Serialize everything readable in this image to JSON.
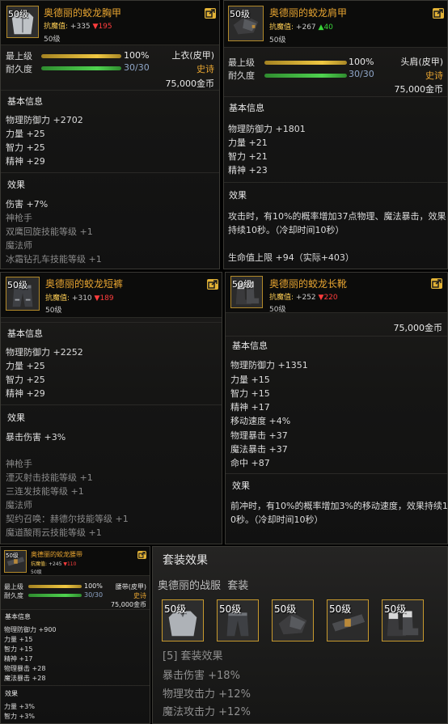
{
  "panels": [
    {
      "level_tag": "50级",
      "name": "奥德丽的蛟龙胸甲",
      "resist_label": "抗魔值:",
      "resist_value": "+335",
      "resist_change": "▼195",
      "level": "50级",
      "max_label": "最上级",
      "max_pct": "100%",
      "max_fill": 1.0,
      "dur_label": "耐久度",
      "dur_value": "30/30",
      "dur_fill": 1.0,
      "slot": "上衣(皮甲)",
      "rarity": "史诗",
      "price": "75,000金币",
      "basic_title": "基本信息",
      "stats": [
        "物理防御力 +2702",
        "力量 +25",
        "智力 +25",
        "精神 +29"
      ],
      "effect_title": "效果",
      "effects": [
        {
          "text": "伤害 +7%",
          "dim": false
        },
        {
          "text": "神枪手",
          "dim": true
        },
        {
          "text": "双鹰回旋技能等级 +1",
          "dim": true
        },
        {
          "text": "魔法师",
          "dim": true
        },
        {
          "text": "冰霜钻孔车技能等级 +1",
          "dim": true
        }
      ]
    },
    {
      "level_tag": "50级",
      "name": "奥德丽的蛟龙肩甲",
      "resist_label": "抗魔值:",
      "resist_value": "+267",
      "resist_change": "▲40",
      "level": "50级",
      "max_label": "最上级",
      "max_pct": "100%",
      "max_fill": 1.0,
      "dur_label": "耐久度",
      "dur_value": "30/30",
      "dur_fill": 1.0,
      "slot": "头肩(皮甲)",
      "rarity": "史诗",
      "price": "75,000金币",
      "basic_title": "基本信息",
      "stats": [
        "物理防御力 +1801",
        "力量 +21",
        "智力 +21",
        "精神 +23"
      ],
      "effect_title": "效果",
      "desc": [
        "攻击时，有10%的概率增加37点物理、魔法暴击，效果",
        "持续10秒。（冷却时间10秒）"
      ],
      "extra": "生命值上限 +94（实际+403）"
    },
    {
      "level_tag": "50级",
      "name": "奥德丽的蛟龙短裤",
      "resist_label": "抗魔值:",
      "resist_value": "+310",
      "resist_change": "▼189",
      "level": "50级",
      "basic_title": "基本信息",
      "stats": [
        "物理防御力 +2252",
        "力量 +25",
        "智力 +25",
        "精神 +29"
      ],
      "effect_title": "效果",
      "effects": [
        {
          "text": "暴击伤害 +3%",
          "dim": false
        },
        {
          "text": "",
          "dim": true
        },
        {
          "text": "神枪手",
          "dim": true
        },
        {
          "text": "湮灭射击技能等级 +1",
          "dim": true
        },
        {
          "text": "三连发技能等级 +1",
          "dim": true
        },
        {
          "text": "魔法师",
          "dim": true
        },
        {
          "text": "契约召唤：赫德尔技能等级 +1",
          "dim": true
        },
        {
          "text": "魔道酸雨云技能等级 +1",
          "dim": true
        }
      ]
    },
    {
      "level_tag": "50级",
      "name": "奥德丽的蛟龙长靴",
      "resist_label": "抗魔值:",
      "resist_value": "+252",
      "resist_change": "▼220",
      "level": "50级",
      "price": "75,000金币",
      "basic_title": "基本信息",
      "stats": [
        "物理防御力 +1351",
        "力量 +15",
        "智力 +15",
        "精神 +17",
        "移动速度 +4%",
        "物理暴击 +37",
        "魔法暴击 +37",
        "命中 +87"
      ],
      "effect_title": "效果",
      "desc": [
        "前冲时，有10%的概率增加3%的移动速度，效果持续1",
        "0秒。（冷却时间10秒）"
      ]
    },
    {
      "level_tag": "50级",
      "name": "奥德丽的蛟龙腰带",
      "resist_label": "抗魔值:",
      "resist_value": "+245",
      "resist_change": "▼110",
      "level": "50级",
      "max_label": "最上级",
      "max_pct": "100%",
      "max_fill": 1.0,
      "dur_label": "耐久度",
      "dur_value": "30/30",
      "dur_fill": 1.0,
      "slot": "腰带(皮甲)",
      "rarity": "史诗",
      "price": "75,000金币",
      "basic_title": "基本信息",
      "stats": [
        "物理防御力 +900",
        "力量 +15",
        "智力 +15",
        "精神 +17",
        "物理暴击 +28",
        "魔法暴击 +28"
      ],
      "effect_title": "效果",
      "effects": [
        {
          "text": "力量 +3%",
          "dim": false
        },
        {
          "text": "智力 +3%",
          "dim": false
        }
      ]
    }
  ],
  "set": {
    "title": "套装效果",
    "name": "奥德丽的战服  套装",
    "items": [
      {
        "level": "50级",
        "icon": "chest-armor-icon"
      },
      {
        "level": "50级",
        "icon": "pants-icon"
      },
      {
        "level": "50级",
        "icon": "shoulder-armor-icon"
      },
      {
        "level": "50级",
        "icon": "belt-icon"
      },
      {
        "level": "50级",
        "icon": "boots-icon"
      }
    ],
    "bonus_title": "[5] 套装效果",
    "bonuses": [
      "暴击伤害 +18%",
      "物理攻击力 +12%",
      "魔法攻击力 +12%"
    ]
  }
}
